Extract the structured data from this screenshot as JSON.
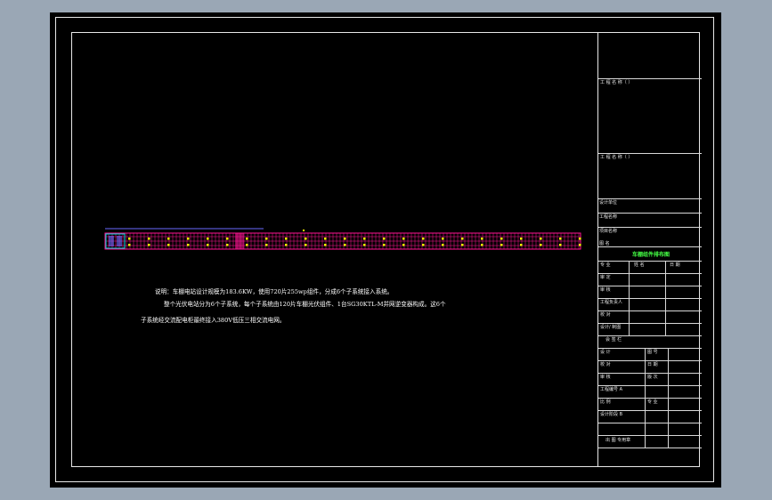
{
  "description_lines": [
    "说明：车棚电站设计规模为183.6KW，使用720片255wp组件，分成6个子系统接入系统。",
    "整个光伏电站分为6个子系统，每个子系统由120片车棚光伏组件、1台SG30KTL-M并网逆变器构成。这6个",
    "子系统经交流配电柜最终接入380V低压三相交流电网。"
  ],
  "title_block": {
    "drawing_title": "车棚组件排布图",
    "labels": [
      "工 程 名 称（ ）",
      "工 程 名 称（ ）",
      "设计单位",
      "工程名称",
      "项目名称",
      "图 名",
      "专 业",
      "设 计",
      "校 对",
      "审 核",
      "工程编号 A",
      "比 例",
      "设计阶段 B",
      "会 签 栏",
      "专 业",
      "姓 名",
      "日 期",
      "审 定",
      "审 核",
      "工程负责人",
      "校 对",
      "设计/ 制图",
      "图 号",
      "日 期",
      "版 次",
      "出 图 专用章"
    ]
  },
  "colors": {
    "background": "#9aa7b5",
    "sheet": "#000000",
    "frame": "#e8e8e8",
    "array_magenta": "#ff1493",
    "array_blue": "#6a6aff",
    "array_cyan": "#00e0e0",
    "marker_yellow": "#ffff00",
    "title_green": "#44ff44",
    "text": "#ffffff"
  }
}
